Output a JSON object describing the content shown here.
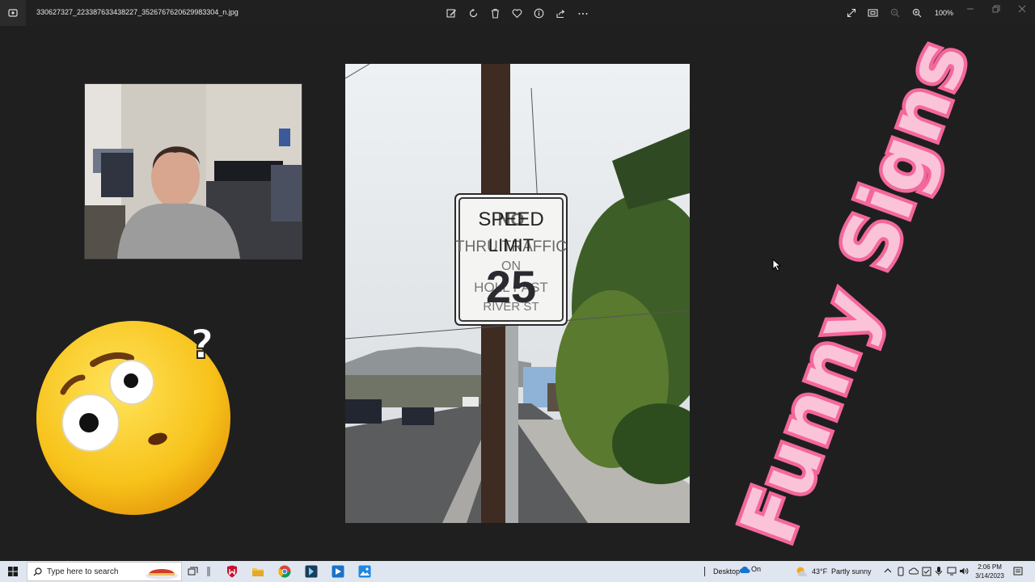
{
  "window": {
    "filename": "330627327_223387633438227_3526767620629983304_n.jpg",
    "zoom_label": "100%"
  },
  "toolbar": {
    "edit_label": "Edit image",
    "rotate_label": "Rotate",
    "delete_label": "Delete",
    "favorite_label": "Favorite",
    "info_label": "File information",
    "share_label": "Share",
    "more_label": "See more"
  },
  "sign": {
    "line1_overlay": "SPEED",
    "line1_base": "NO",
    "line2_overlay": "LIMIT",
    "line2_base": "THRU TRAFFIC",
    "line3": "ON",
    "line4": "HOLL PAST",
    "line5": "RIVER ST",
    "number": "25"
  },
  "overlay": {
    "funny_signs": "Funny Signs"
  },
  "taskbar": {
    "search_placeholder": "Type here to search",
    "desktop_label": "Desktop",
    "onedrive_status": "On",
    "weather_temp": "43°F",
    "weather_desc": "Partly sunny",
    "clock_time": "2:06 PM",
    "clock_date": "3/14/2023"
  },
  "colors": {
    "background": "#1f1f1f",
    "accent_pink": "#f4679c",
    "taskbar": "#dfe6ef",
    "emoji_yellow": "#f7c21a"
  }
}
